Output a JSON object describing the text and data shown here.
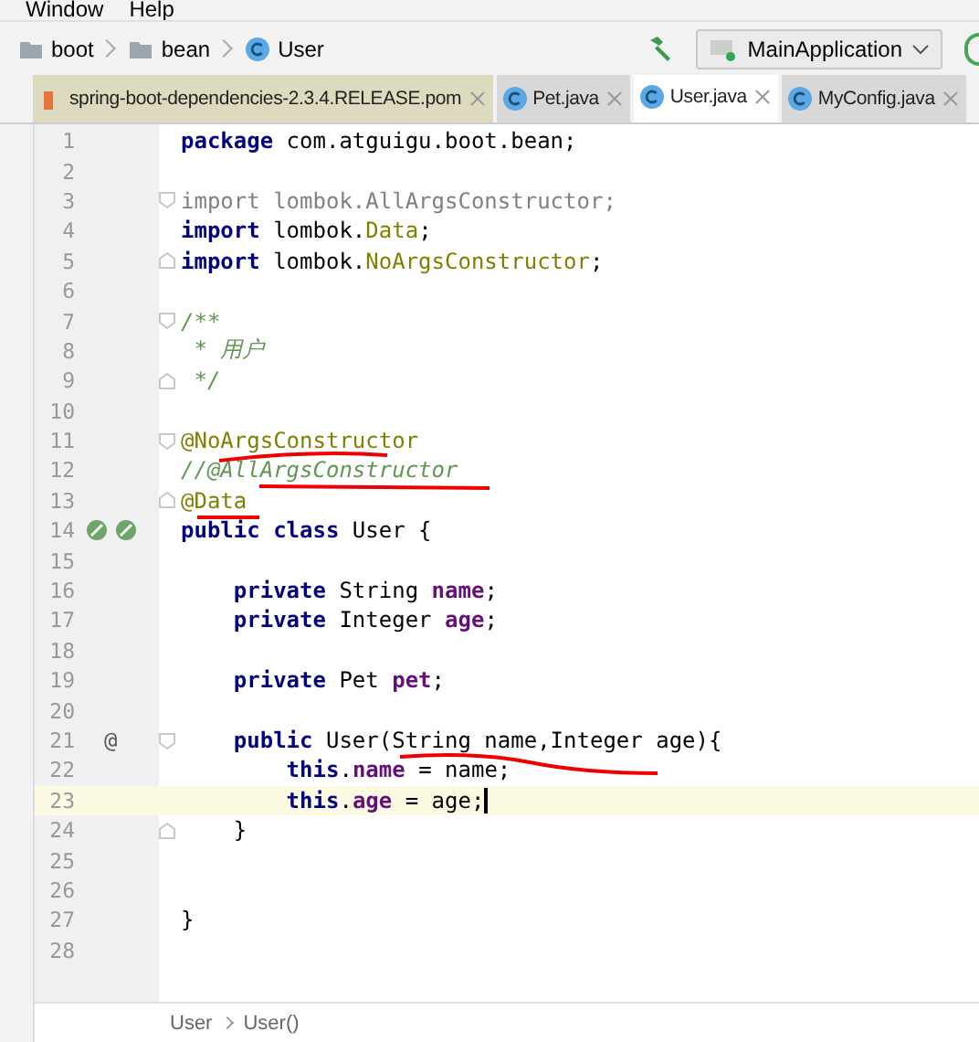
{
  "menu": [
    "Window",
    "Help"
  ],
  "breadcrumbs": [
    {
      "label": "boot",
      "kind": "folder"
    },
    {
      "label": "bean",
      "kind": "folder"
    },
    {
      "label": "User",
      "kind": "class"
    }
  ],
  "run_config": {
    "label": "MainApplication"
  },
  "tabs": [
    {
      "label": "spring-boot-dependencies-2.3.4.RELEASE.pom",
      "kind": "pom",
      "selected": false
    },
    {
      "label": "Pet.java",
      "kind": "class",
      "selected": false
    },
    {
      "label": "User.java",
      "kind": "class",
      "selected": true
    },
    {
      "label": "MyConfig.java",
      "kind": "class",
      "selected": false
    }
  ],
  "lines": [
    {
      "number": "1",
      "current": false,
      "fold_start": false,
      "fold_end": false,
      "gutter_icons": false,
      "tokens": [
        {
          "kind": "kw",
          "text": "package"
        },
        {
          "kind": "plain",
          "text": " com.atguigu.boot.bean;"
        }
      ]
    },
    {
      "number": "2",
      "current": false,
      "fold_start": false,
      "fold_end": false,
      "gutter_icons": false
    },
    {
      "number": "3",
      "current": false,
      "fold_start": true,
      "fold_end": false,
      "gutter_icons": false,
      "tokens": [
        {
          "kind": "unused",
          "text": "import lombok.AllArgsConstructor;"
        }
      ]
    },
    {
      "number": "4",
      "current": false,
      "fold_start": false,
      "fold_end": false,
      "gutter_icons": false,
      "tokens": [
        {
          "kind": "kw",
          "text": "import"
        },
        {
          "kind": "plain",
          "text": " lombok."
        },
        {
          "kind": "ann",
          "text": "Data"
        },
        {
          "kind": "plain",
          "text": ";"
        }
      ]
    },
    {
      "number": "5",
      "current": false,
      "fold_start": false,
      "fold_end": true,
      "gutter_icons": false,
      "tokens": [
        {
          "kind": "kw",
          "text": "import"
        },
        {
          "kind": "plain",
          "text": " lombok."
        },
        {
          "kind": "ann",
          "text": "NoArgsConstructor"
        },
        {
          "kind": "plain",
          "text": ";"
        }
      ]
    },
    {
      "number": "6",
      "current": false,
      "fold_start": false,
      "fold_end": false,
      "gutter_icons": false
    },
    {
      "number": "7",
      "current": false,
      "fold_start": true,
      "fold_end": false,
      "gutter_icons": false,
      "tokens": [
        {
          "kind": "comment",
          "text": "/**"
        }
      ]
    },
    {
      "number": "8",
      "current": false,
      "fold_start": false,
      "fold_end": false,
      "gutter_icons": false,
      "tokens": [
        {
          "kind": "comment",
          "text": " * 用户"
        }
      ]
    },
    {
      "number": "9",
      "current": false,
      "fold_start": false,
      "fold_end": true,
      "gutter_icons": false,
      "tokens": [
        {
          "kind": "comment",
          "text": " */"
        }
      ]
    },
    {
      "number": "10",
      "current": false,
      "fold_start": false,
      "fold_end": false,
      "gutter_icons": false
    },
    {
      "number": "11",
      "current": false,
      "fold_start": true,
      "fold_end": false,
      "gutter_icons": false,
      "tokens": [
        {
          "kind": "ann",
          "text": "@NoArgsConstructor"
        }
      ]
    },
    {
      "number": "12",
      "current": false,
      "fold_start": false,
      "fold_end": false,
      "gutter_icons": false,
      "tokens": [
        {
          "kind": "comment",
          "text": "//@AllArgsConstructor"
        }
      ]
    },
    {
      "number": "13",
      "current": false,
      "fold_start": false,
      "fold_end": true,
      "gutter_icons": false,
      "tokens": [
        {
          "kind": "ann",
          "text": "@Data"
        }
      ]
    },
    {
      "number": "14",
      "current": false,
      "fold_start": false,
      "fold_end": false,
      "gutter_icons": true,
      "tokens": [
        {
          "kind": "kw",
          "text": "public class"
        },
        {
          "kind": "plain",
          "text": " User {"
        }
      ]
    },
    {
      "number": "15",
      "current": false,
      "fold_start": false,
      "fold_end": false,
      "gutter_icons": false
    },
    {
      "number": "16",
      "current": false,
      "fold_start": false,
      "fold_end": false,
      "gutter_icons": false,
      "tokens": [
        {
          "kind": "kw",
          "text": "    private"
        },
        {
          "kind": "plain",
          "text": " String "
        },
        {
          "kind": "field",
          "text": "name"
        },
        {
          "kind": "plain",
          "text": ";"
        }
      ]
    },
    {
      "number": "17",
      "current": false,
      "fold_start": false,
      "fold_end": false,
      "gutter_icons": false,
      "tokens": [
        {
          "kind": "kw",
          "text": "    private"
        },
        {
          "kind": "plain",
          "text": " Integer "
        },
        {
          "kind": "field",
          "text": "age"
        },
        {
          "kind": "plain",
          "text": ";"
        }
      ]
    },
    {
      "number": "18",
      "current": false,
      "fold_start": false,
      "fold_end": false,
      "gutter_icons": false
    },
    {
      "number": "19",
      "current": false,
      "fold_start": false,
      "fold_end": false,
      "gutter_icons": false,
      "tokens": [
        {
          "kind": "kw",
          "text": "    private"
        },
        {
          "kind": "plain",
          "text": " Pet "
        },
        {
          "kind": "field",
          "text": "pet"
        },
        {
          "kind": "plain",
          "text": ";"
        }
      ]
    },
    {
      "number": "20",
      "current": false,
      "fold_start": false,
      "fold_end": false,
      "gutter_icons": false
    },
    {
      "number": "21",
      "current": false,
      "fold_start": true,
      "fold_end": false,
      "gutter_icons": false,
      "gutter_text": "@",
      "tokens": [
        {
          "kind": "kw",
          "text": "    public"
        },
        {
          "kind": "plain",
          "text": " User(String name,Integer age){"
        }
      ]
    },
    {
      "number": "22",
      "current": false,
      "fold_start": false,
      "fold_end": false,
      "gutter_icons": false,
      "tokens": [
        {
          "kind": "kw",
          "text": "        this"
        },
        {
          "kind": "plain",
          "text": "."
        },
        {
          "kind": "field",
          "text": "name"
        },
        {
          "kind": "plain",
          "text": " = name;"
        }
      ]
    },
    {
      "number": "23",
      "current": true,
      "fold_start": false,
      "fold_end": false,
      "gutter_icons": false,
      "tokens": [
        {
          "kind": "kw",
          "text": "        this"
        },
        {
          "kind": "plain",
          "text": "."
        },
        {
          "kind": "field",
          "text": "age"
        },
        {
          "kind": "plain",
          "text": " = age;"
        }
      ]
    },
    {
      "number": "24",
      "current": false,
      "fold_start": false,
      "fold_end": true,
      "gutter_icons": false,
      "tokens": [
        {
          "kind": "plain",
          "text": "    }"
        }
      ]
    },
    {
      "number": "25",
      "current": false,
      "fold_start": false,
      "fold_end": false,
      "gutter_icons": false
    },
    {
      "number": "26",
      "current": false,
      "fold_start": false,
      "fold_end": false,
      "gutter_icons": false
    },
    {
      "number": "27",
      "current": false,
      "fold_start": false,
      "fold_end": false,
      "gutter_icons": false,
      "tokens": [
        {
          "kind": "plain",
          "text": "}"
        }
      ]
    },
    {
      "number": "28",
      "current": false,
      "fold_start": false,
      "fold_end": false,
      "gutter_icons": false
    }
  ],
  "footer_breadcrumbs": [
    "User",
    "User()"
  ]
}
